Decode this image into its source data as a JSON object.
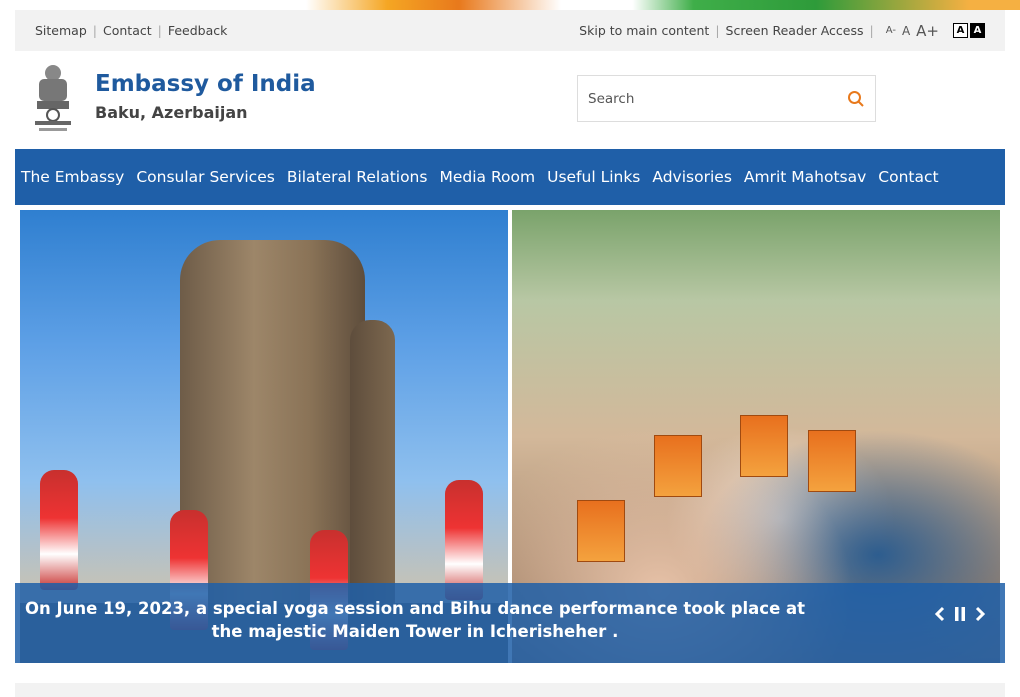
{
  "utility": {
    "links": [
      "Sitemap",
      "Contact",
      "Feedback"
    ],
    "skip": "Skip to main content",
    "screen_reader": "Screen Reader Access",
    "font_small": "A-",
    "font_normal": "A",
    "font_large": "A+",
    "contrast_light": "A",
    "contrast_dark": "A"
  },
  "header": {
    "title": "Embassy of India",
    "subtitle": "Baku, Azerbaijan",
    "search_placeholder": "Search"
  },
  "nav": {
    "items": [
      "The Embassy",
      "Consular Services",
      "Bilateral Relations",
      "Media Room",
      "Useful Links",
      "Advisories",
      "Amrit Mahotsav",
      "Contact"
    ]
  },
  "slider": {
    "caption": "On June 19, 2023, a special yoga session and Bihu dance performance took place at the majestic Maiden Tower in Icherisheher .",
    "prev": "❮",
    "pause": "❚❚",
    "next": "❯"
  },
  "colors": {
    "nav_bg": "#1f5fa8",
    "title": "#1f5a9e",
    "search_icon": "#e8791c"
  }
}
